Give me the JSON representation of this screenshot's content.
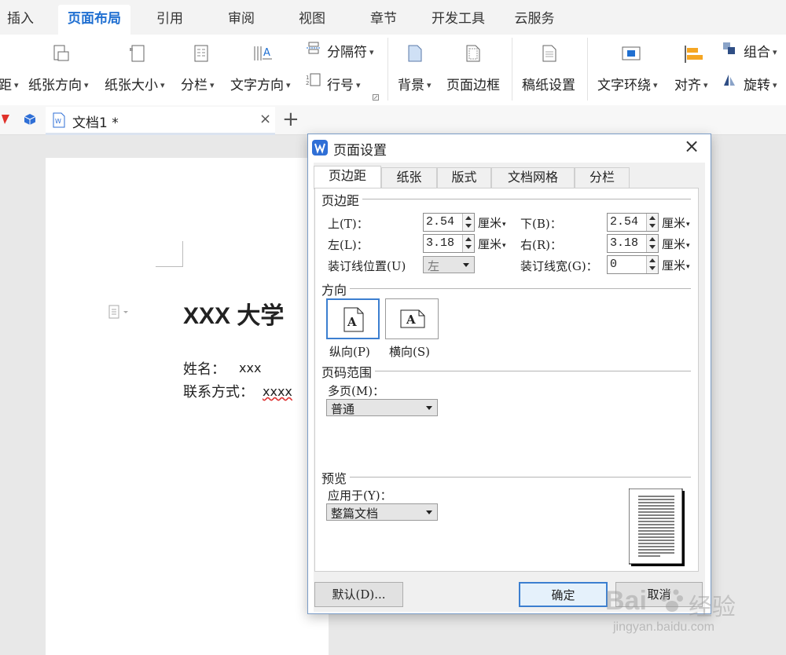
{
  "menu": {
    "tabs": [
      "插入",
      "页面布局",
      "引用",
      "审阅",
      "视图",
      "章节",
      "开发工具",
      "云服务"
    ],
    "active": "页面布局"
  },
  "ribbon": {
    "margin_partial": "距",
    "paper_orientation": "纸张方向",
    "paper_size": "纸张大小",
    "columns": "分栏",
    "text_direction": "文字方向",
    "separator": "分隔符",
    "line_numbers": "行号",
    "background": "背景",
    "page_border": "页面边框",
    "manuscript_settings": "稿纸设置",
    "text_wrap": "文字环绕",
    "align": "对齐",
    "group": "组合",
    "rotate": "旋转"
  },
  "doc_tabs": {
    "title": "文档1 *",
    "close_glyph": "×",
    "new_glyph": "+"
  },
  "document": {
    "heading": "XXX 大学",
    "name_label": "姓名：",
    "name_value": "xxx",
    "contact_label": "联系方式：",
    "contact_value": "xxxx"
  },
  "dialog": {
    "title": "页面设置",
    "close_glyph": "×",
    "tabs": [
      "页边距",
      "纸张",
      "版式",
      "文档网格",
      "分栏"
    ],
    "active_tab": "页边距",
    "margins": {
      "group_label": "页边距",
      "top_label": "上(T)：",
      "top_value": "2.54",
      "bottom_label": "下(B)：",
      "bottom_value": "2.54",
      "left_label": "左(L)：",
      "left_value": "3.18",
      "right_label": "右(R)：",
      "right_value": "3.18",
      "gutter_pos_label": "装订线位置(U)",
      "gutter_pos_value": "左",
      "gutter_width_label": "装订线宽(G)：",
      "gutter_width_value": "0",
      "unit": "厘米"
    },
    "orientation": {
      "group_label": "方向",
      "portrait": "纵向(P)",
      "landscape": "横向(S)",
      "icon_letter": "A",
      "selected": "纵向(P)"
    },
    "pages": {
      "group_label": "页码范围",
      "multiple_label": "多页(M)：",
      "multiple_value": "普通"
    },
    "preview": {
      "group_label": "预览",
      "apply_label": "应用于(Y)：",
      "apply_value": "整篇文档"
    },
    "buttons": {
      "default": "默认(D)...",
      "ok": "确定",
      "cancel": "取消"
    }
  },
  "watermark": {
    "brand": "Bai",
    "brand_suffix": "经验",
    "url": "jingyan.baidu.com"
  },
  "colors": {
    "accent": "#1f6fd1",
    "dialog_border": "#7a9cc7",
    "ok_border": "#3c7fd0"
  }
}
